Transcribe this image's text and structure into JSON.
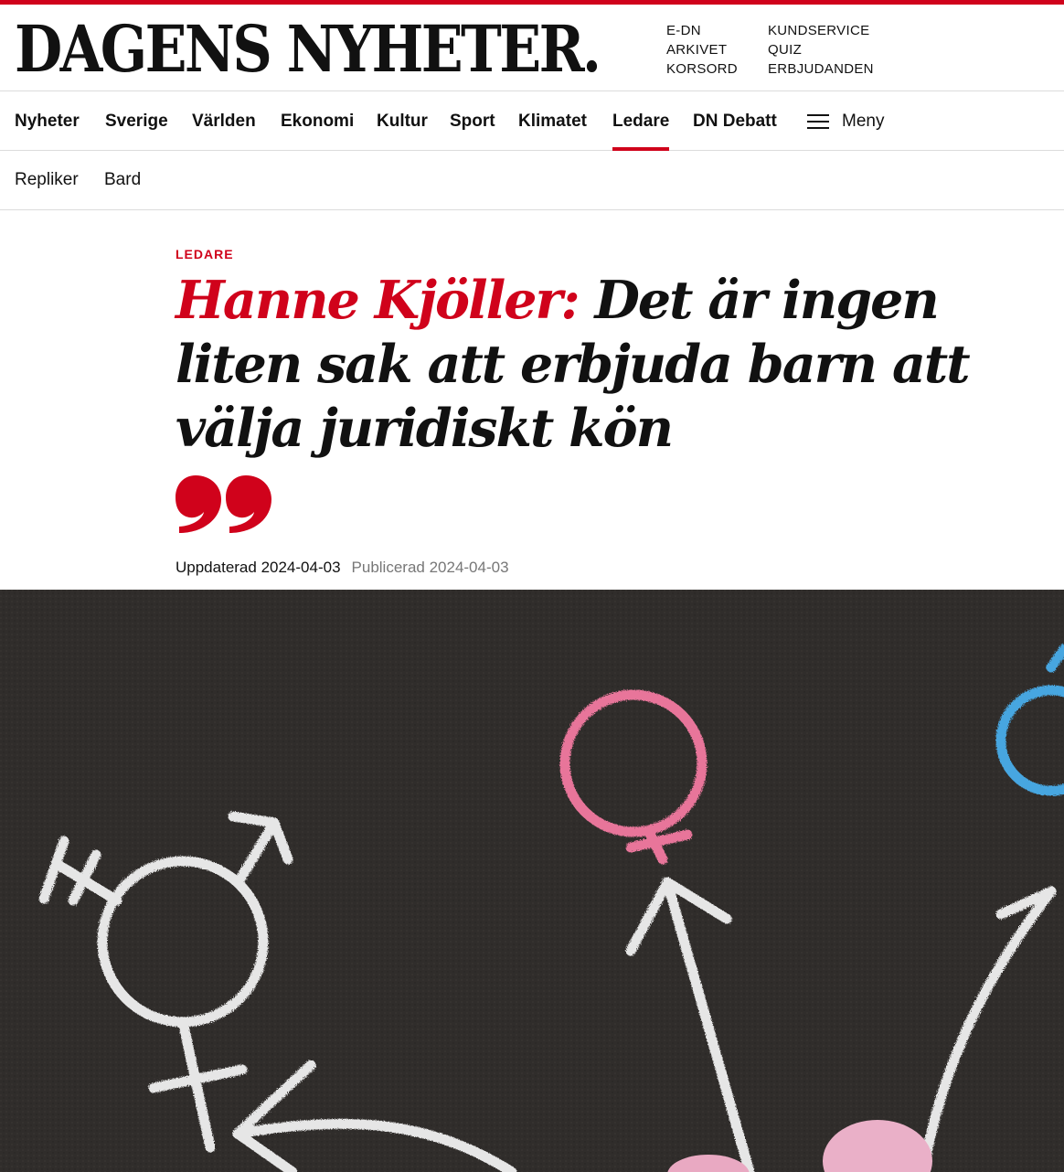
{
  "brand": {
    "logo": "DAGENS NYHETER.",
    "accent_color": "#d0021b"
  },
  "utility_links": {
    "col1": [
      "E-DN",
      "ARKIVET",
      "KORSORD"
    ],
    "col2": [
      "KUNDSERVICE",
      "QUIZ",
      "ERBJUDANDEN"
    ]
  },
  "main_nav": {
    "items": [
      "Nyheter",
      "Sverige",
      "Världen",
      "Ekonomi",
      "Kultur",
      "Sport",
      "Klimatet",
      "Ledare",
      "DN Debatt"
    ],
    "active": "Ledare",
    "menu_label": "Meny",
    "menu_icon": "hamburger-icon"
  },
  "sub_nav": {
    "items": [
      "Repliker",
      "Bard"
    ]
  },
  "article": {
    "section": "LEDARE",
    "author_prefix": "Hanne Kjöller:",
    "title": "Det är ingen liten sak att erbjuda barn att välja juridiskt kön",
    "quote_icon": "quote-icon",
    "updated": "Uppdaterad 2024-04-03",
    "published": "Publicerad 2024-04-03"
  },
  "hero_image": {
    "subject": "chalk-gender-symbols-photo",
    "colors": {
      "asphalt": "#2f2c2a",
      "chalk_white": "#e6e6e6",
      "chalk_pink": "#e8759a",
      "chalk_blue": "#46a6e0"
    }
  }
}
